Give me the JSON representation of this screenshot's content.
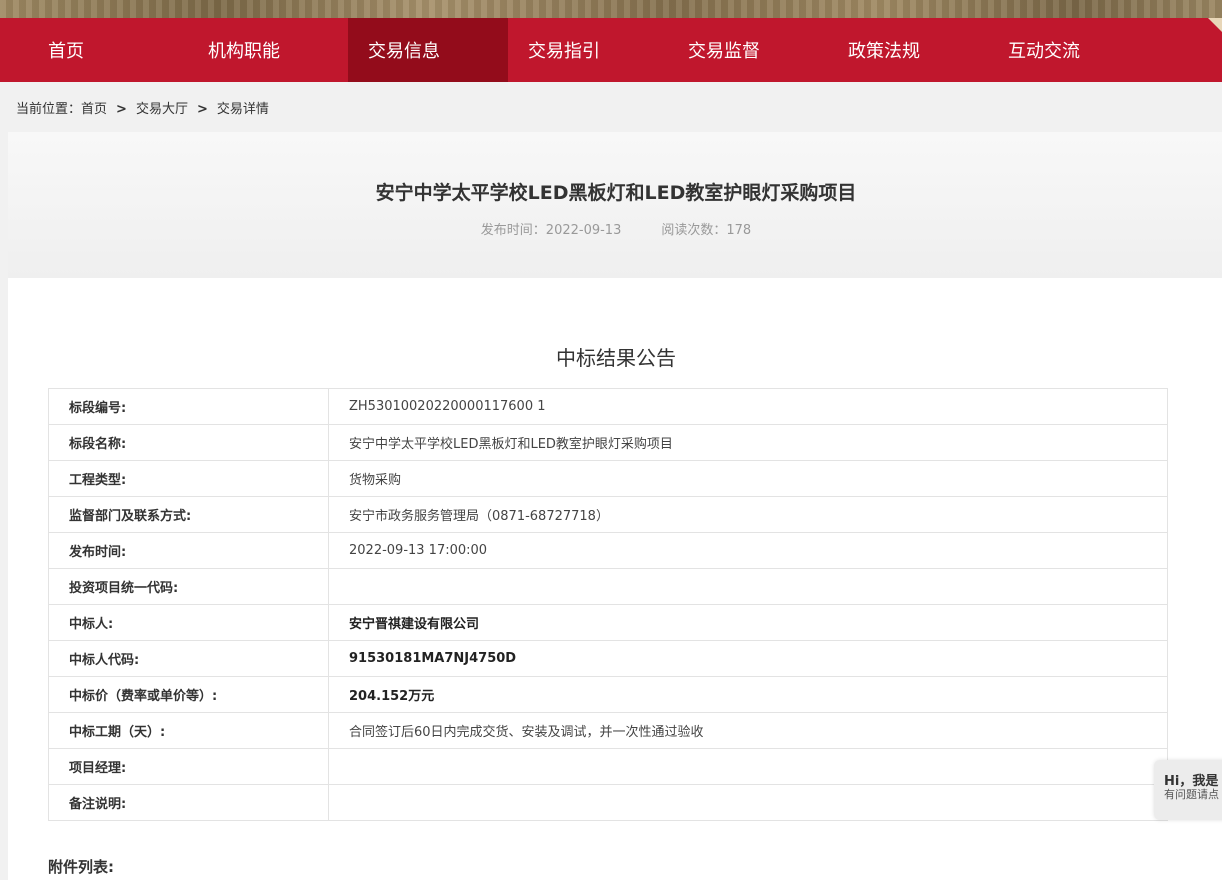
{
  "nav": {
    "items": [
      "首页",
      "机构职能",
      "交易信息",
      "交易指引",
      "交易监督",
      "政策法规",
      "互动交流"
    ],
    "active_index": 2
  },
  "breadcrumb": {
    "prefix": "当前位置：",
    "items": [
      "首页",
      "交易大厅",
      "交易详情"
    ],
    "separator": ">"
  },
  "article": {
    "title": "安宁中学太平学校LED黑板灯和LED教室护眼灯采购项目",
    "publish_label": "发布时间：2022-09-13",
    "views_label": "阅读次数：178"
  },
  "notice": {
    "title": "中标结果公告",
    "rows": [
      {
        "label": "标段编号:",
        "value": "ZH53010020220000117600 1"
      },
      {
        "label": "标段名称:",
        "value": "安宁中学太平学校LED黑板灯和LED教室护眼灯采购项目"
      },
      {
        "label": "工程类型:",
        "value": "货物采购"
      },
      {
        "label": "监督部门及联系方式:",
        "value": "安宁市政务服务管理局（0871-68727718）"
      },
      {
        "label": "发布时间:",
        "value": "2022-09-13 17:00:00"
      },
      {
        "label": "投资项目统一代码:",
        "value": ""
      },
      {
        "label": "中标人:",
        "value": "安宁晋祺建设有限公司"
      },
      {
        "label": "中标人代码:",
        "value": "91530181MA7NJ4750D"
      },
      {
        "label": "中标价（费率或单价等）:",
        "value": "204.152万元"
      },
      {
        "label": "中标工期（天）:",
        "value": "合同签订后60日内完成交货、安装及调试，并一次性通过验收"
      },
      {
        "label": "项目经理:",
        "value": ""
      },
      {
        "label": "备注说明:",
        "value": ""
      }
    ]
  },
  "attachments_label": "附件列表:",
  "chat": {
    "greeting": "Hi，我是",
    "sub": "有问题请点"
  },
  "colors": {
    "nav_bg": "#c0172d",
    "nav_active": "#930c1b"
  }
}
